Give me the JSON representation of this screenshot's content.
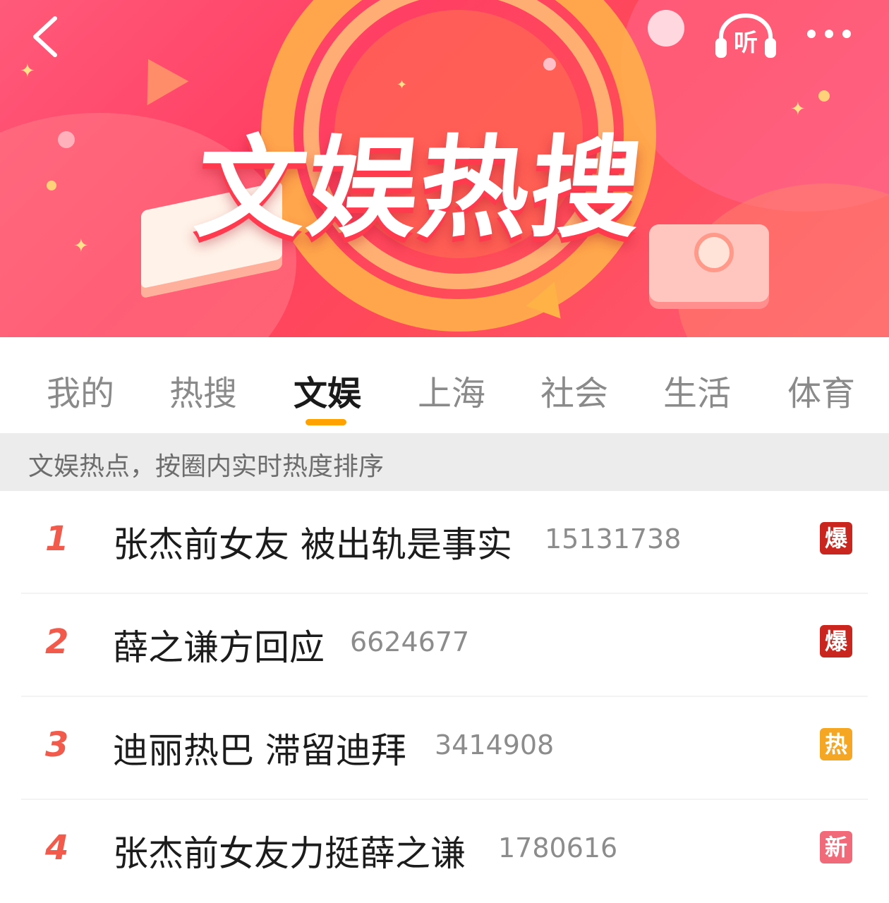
{
  "banner": {
    "title": "文娱热搜",
    "listen_label": "听"
  },
  "tabs": [
    {
      "label": "我的"
    },
    {
      "label": "热搜"
    },
    {
      "label": "文娱",
      "active": true
    },
    {
      "label": "上海"
    },
    {
      "label": "社会"
    },
    {
      "label": "生活"
    },
    {
      "label": "体育"
    }
  ],
  "subtitle": "文娱热点，按圈内实时热度排序",
  "list": [
    {
      "rank": "1",
      "topic": "张杰前女友 被出轨是事实",
      "count": "15131738",
      "badge": "爆",
      "badge_color": "#c8261e"
    },
    {
      "rank": "2",
      "topic": "薛之谦方回应",
      "count": "6624677",
      "badge": "爆",
      "badge_color": "#c8261e"
    },
    {
      "rank": "3",
      "topic": "迪丽热巴 滞留迪拜",
      "count": "3414908",
      "badge": "热",
      "badge_color": "#f5a623"
    },
    {
      "rank": "4",
      "topic": "张杰前女友力挺薛之谦",
      "count": "1780616",
      "badge": "新",
      "badge_color": "#f06a7a"
    }
  ],
  "colors": {
    "accent": "#ffa200",
    "rank": "#f25a4b",
    "banner": "#ff3f63"
  },
  "icons": {
    "back": "chevron-left-icon",
    "listen": "headphones-icon",
    "more": "more-dots-icon"
  }
}
